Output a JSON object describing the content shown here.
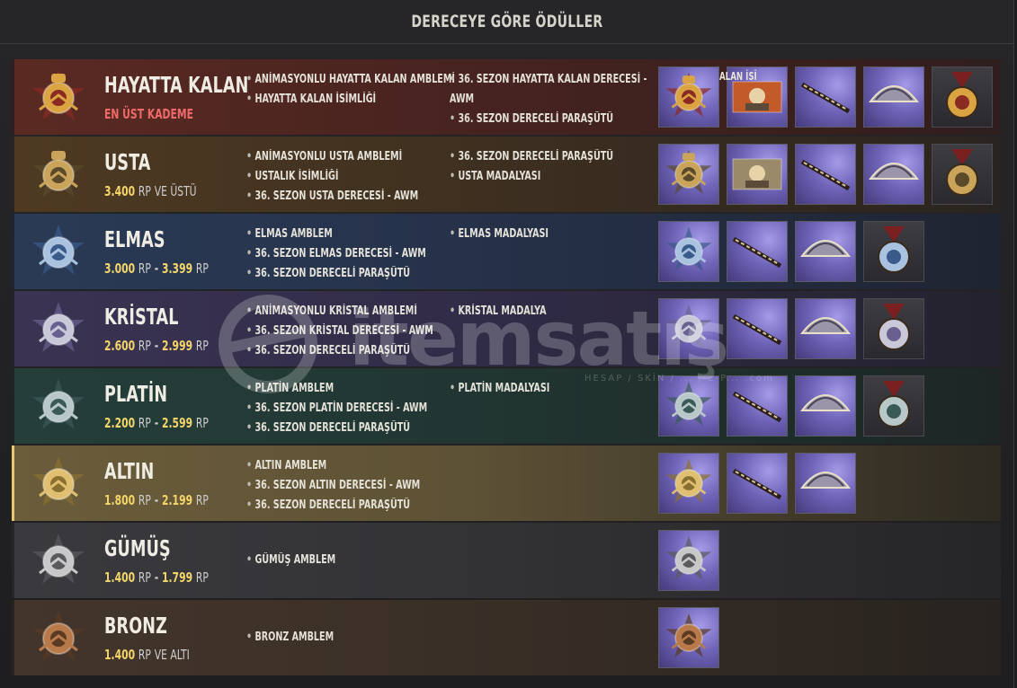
{
  "header": {
    "title": "DERECEYE GÖRE ÖDÜLLER"
  },
  "watermark": {
    "text": "itemsatış",
    "sub": "HESAP / SKİN / ... / E-P... .com"
  },
  "tiers": [
    {
      "name": "HAYATTA KALAN",
      "subtitle": "EN ÜST KADEME",
      "col1": [
        "ANİMASYONLU HAYATTA KALAN AMBLEMİ",
        "HAYATTA KALAN İSİMLİĞİ"
      ],
      "col2": [
        "36. SEZON HAYATTA KALAN DERECESİ -",
        "AWM",
        "36. SEZON DERECELİ PARAŞÜTÜ"
      ],
      "item_overlay_text": "ALAN İSİ",
      "items": [
        "conqueror-emblem",
        "nameplate-card",
        "awm-skin",
        "parachute-skin",
        "conqueror-medal"
      ]
    },
    {
      "name": "USTA",
      "rp_from": "3.400",
      "rp_unit": "RP",
      "rp_suffix": "VE ÜSTÜ",
      "col1": [
        "ANİMASYONLU USTA AMBLEMİ",
        "USTALIK İSİMLİĞİ",
        "36. SEZON USTA DERECESİ - AWM"
      ],
      "col2": [
        "36. SEZON DERECELİ PARAŞÜTÜ",
        "USTA MADALYASI"
      ],
      "items": [
        "ace-emblem",
        "nameplate-card",
        "awm-skin",
        "parachute-skin",
        "ace-medal"
      ]
    },
    {
      "name": "ELMAS",
      "rp_from": "3.000",
      "rp_to": "3.399",
      "rp_unit": "RP",
      "col1": [
        "ELMAS AMBLEM",
        "36. SEZON ELMAS DERECESİ - AWM",
        "36. SEZON DERECELİ PARAŞÜTÜ"
      ],
      "col2": [
        "ELMAS MADALYASI"
      ],
      "items": [
        "diamond-emblem",
        "awm-skin",
        "parachute-skin",
        "diamond-medal"
      ]
    },
    {
      "name": "KRİSTAL",
      "rp_from": "2.600",
      "rp_to": "2.999",
      "rp_unit": "RP",
      "col1": [
        "ANİMASYONLU KRİSTAL AMBLEMİ",
        "36. SEZON KRİSTAL DERECESİ - AWM",
        "36. SEZON DERECELİ PARAŞÜTÜ"
      ],
      "col2": [
        "KRİSTAL MADALYA"
      ],
      "items": [
        "crystal-emblem",
        "awm-skin",
        "parachute-skin",
        "crystal-medal"
      ]
    },
    {
      "name": "PLATİN",
      "rp_from": "2.200",
      "rp_to": "2.599",
      "rp_unit": "RP",
      "col1": [
        "PLATİN AMBLEM",
        "36. SEZON PLATİN DERECESİ - AWM",
        "36. SEZON DERECELİ PARAŞÜTÜ"
      ],
      "col2": [
        "PLATİN MADALYASI"
      ],
      "items": [
        "platinum-emblem",
        "awm-skin",
        "parachute-skin",
        "platinum-medal"
      ]
    },
    {
      "name": "ALTIN",
      "rp_from": "1.800",
      "rp_to": "2.199",
      "rp_unit": "RP",
      "col1": [
        "ALTIN AMBLEM",
        "36. SEZON ALTIN DERECESİ - AWM",
        "36. SEZON DERECELİ PARAŞÜTÜ"
      ],
      "col2": [],
      "items": [
        "gold-emblem",
        "awm-skin",
        "parachute-skin"
      ]
    },
    {
      "name": "GÜMÜŞ",
      "rp_from": "1.400",
      "rp_to": "1.799",
      "rp_unit": "RP",
      "col1": [
        "GÜMÜŞ AMBLEM"
      ],
      "col2": [],
      "items": [
        "silver-emblem"
      ]
    },
    {
      "name": "BRONZ",
      "rp_from": "1.400",
      "rp_unit": "RP",
      "rp_suffix": "VE ALTI",
      "col1": [
        "BRONZ AMBLEM"
      ],
      "col2": [],
      "items": [
        "bronze-emblem"
      ]
    }
  ],
  "colors": {
    "accent_gold": "#f3d56a",
    "top_tier_red": "#f06a6a",
    "selected_border": "#e8c86a"
  }
}
